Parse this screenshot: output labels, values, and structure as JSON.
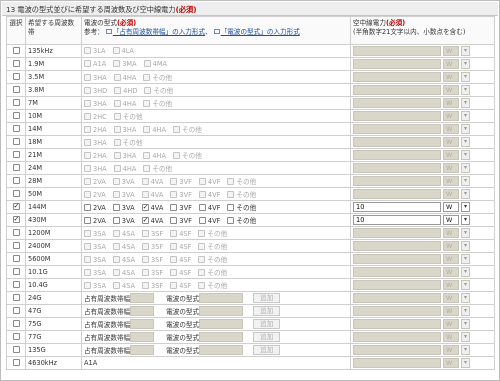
{
  "section": {
    "title_prefix": "13 電波の型式並びに希望する周波数及び空中線電力",
    "title_required": "(必須)"
  },
  "header": {
    "select_label": "選択",
    "band_label": "希望する周波数帯",
    "type_label": "電波の型式",
    "type_required": "(必須)",
    "type_ref_prefix": "参考：",
    "type_link1": "「占有周波数帯幅」の入力形式",
    "type_link_sep": "、",
    "type_link2": "「電波の型式」の入力形式",
    "power_label": "空中線電力",
    "power_required": "(必須)",
    "power_note": "(半角数字21文字以内、小数点を含む)"
  },
  "rows": [
    {
      "band": "135kHz",
      "checked": false,
      "options": [
        {
          "label": "3LA",
          "on": false,
          "dis": true
        },
        {
          "label": "4LA",
          "on": false,
          "dis": true
        }
      ],
      "power": "",
      "unit": "W",
      "enabled": false
    },
    {
      "band": "1.9M",
      "checked": false,
      "options": [
        {
          "label": "A1A",
          "on": false,
          "dis": true
        },
        {
          "label": "3MA",
          "on": false,
          "dis": true
        },
        {
          "label": "4MA",
          "on": false,
          "dis": true
        }
      ],
      "power": "",
      "unit": "W",
      "enabled": false
    },
    {
      "band": "3.5M",
      "checked": false,
      "options": [
        {
          "label": "3HA",
          "on": false,
          "dis": true
        },
        {
          "label": "4HA",
          "on": false,
          "dis": true
        },
        {
          "label": "その他",
          "on": false,
          "dis": true
        }
      ],
      "power": "",
      "unit": "W",
      "enabled": false
    },
    {
      "band": "3.8M",
      "checked": false,
      "options": [
        {
          "label": "3HD",
          "on": false,
          "dis": true
        },
        {
          "label": "4HD",
          "on": false,
          "dis": true
        },
        {
          "label": "その他",
          "on": false,
          "dis": true
        }
      ],
      "power": "",
      "unit": "W",
      "enabled": false
    },
    {
      "band": "7M",
      "checked": false,
      "options": [
        {
          "label": "3HA",
          "on": false,
          "dis": true
        },
        {
          "label": "4HA",
          "on": false,
          "dis": true
        },
        {
          "label": "その他",
          "on": false,
          "dis": true
        }
      ],
      "power": "",
      "unit": "W",
      "enabled": false
    },
    {
      "band": "10M",
      "checked": false,
      "options": [
        {
          "label": "2HC",
          "on": false,
          "dis": true
        },
        {
          "label": "その他",
          "on": false,
          "dis": true
        }
      ],
      "power": "",
      "unit": "W",
      "enabled": false
    },
    {
      "band": "14M",
      "checked": false,
      "options": [
        {
          "label": "2HA",
          "on": false,
          "dis": true
        },
        {
          "label": "3HA",
          "on": false,
          "dis": true
        },
        {
          "label": "4HA",
          "on": false,
          "dis": true
        },
        {
          "label": "その他",
          "on": false,
          "dis": true
        }
      ],
      "power": "",
      "unit": "W",
      "enabled": false
    },
    {
      "band": "18M",
      "checked": false,
      "options": [
        {
          "label": "3HA",
          "on": false,
          "dis": true
        },
        {
          "label": "その他",
          "on": false,
          "dis": true
        }
      ],
      "power": "",
      "unit": "W",
      "enabled": false
    },
    {
      "band": "21M",
      "checked": false,
      "options": [
        {
          "label": "2HA",
          "on": false,
          "dis": true
        },
        {
          "label": "3HA",
          "on": false,
          "dis": true
        },
        {
          "label": "4HA",
          "on": false,
          "dis": true
        },
        {
          "label": "その他",
          "on": false,
          "dis": true
        }
      ],
      "power": "",
      "unit": "W",
      "enabled": false
    },
    {
      "band": "24M",
      "checked": false,
      "options": [
        {
          "label": "3HA",
          "on": false,
          "dis": true
        },
        {
          "label": "4HA",
          "on": false,
          "dis": true
        },
        {
          "label": "その他",
          "on": false,
          "dis": true
        }
      ],
      "power": "",
      "unit": "W",
      "enabled": false
    },
    {
      "band": "28M",
      "checked": false,
      "options": [
        {
          "label": "2VA",
          "on": false,
          "dis": true
        },
        {
          "label": "3VA",
          "on": false,
          "dis": true
        },
        {
          "label": "4VA",
          "on": false,
          "dis": true
        },
        {
          "label": "3VF",
          "on": false,
          "dis": true
        },
        {
          "label": "4VF",
          "on": false,
          "dis": true
        },
        {
          "label": "その他",
          "on": false,
          "dis": true
        }
      ],
      "power": "",
      "unit": "W",
      "enabled": false
    },
    {
      "band": "50M",
      "checked": false,
      "options": [
        {
          "label": "2VA",
          "on": false,
          "dis": true
        },
        {
          "label": "3VA",
          "on": false,
          "dis": true
        },
        {
          "label": "4VA",
          "on": false,
          "dis": true
        },
        {
          "label": "3VF",
          "on": false,
          "dis": true
        },
        {
          "label": "4VF",
          "on": false,
          "dis": true
        },
        {
          "label": "その他",
          "on": false,
          "dis": true
        }
      ],
      "power": "",
      "unit": "W",
      "enabled": false
    },
    {
      "band": "144M",
      "checked": true,
      "options": [
        {
          "label": "2VA",
          "on": false,
          "dis": false
        },
        {
          "label": "3VA",
          "on": false,
          "dis": false
        },
        {
          "label": "4VA",
          "on": true,
          "dis": false
        },
        {
          "label": "3VF",
          "on": false,
          "dis": false
        },
        {
          "label": "4VF",
          "on": false,
          "dis": false
        },
        {
          "label": "その他",
          "on": false,
          "dis": false
        }
      ],
      "power": "10",
      "unit": "W",
      "enabled": true
    },
    {
      "band": "430M",
      "checked": true,
      "options": [
        {
          "label": "2VA",
          "on": false,
          "dis": false
        },
        {
          "label": "3VA",
          "on": false,
          "dis": false
        },
        {
          "label": "4VA",
          "on": true,
          "dis": false
        },
        {
          "label": "3VF",
          "on": false,
          "dis": false
        },
        {
          "label": "4VF",
          "on": false,
          "dis": false
        },
        {
          "label": "その他",
          "on": false,
          "dis": false
        }
      ],
      "power": "10",
      "unit": "W",
      "enabled": true
    },
    {
      "band": "1200M",
      "checked": false,
      "options": [
        {
          "label": "3SA",
          "on": false,
          "dis": true
        },
        {
          "label": "4SA",
          "on": false,
          "dis": true
        },
        {
          "label": "3SF",
          "on": false,
          "dis": true
        },
        {
          "label": "4SF",
          "on": false,
          "dis": true
        },
        {
          "label": "その他",
          "on": false,
          "dis": true
        }
      ],
      "power": "",
      "unit": "W",
      "enabled": false
    },
    {
      "band": "2400M",
      "checked": false,
      "options": [
        {
          "label": "3SA",
          "on": false,
          "dis": true
        },
        {
          "label": "4SA",
          "on": false,
          "dis": true
        },
        {
          "label": "3SF",
          "on": false,
          "dis": true
        },
        {
          "label": "4SF",
          "on": false,
          "dis": true
        },
        {
          "label": "その他",
          "on": false,
          "dis": true
        }
      ],
      "power": "",
      "unit": "W",
      "enabled": false
    },
    {
      "band": "5600M",
      "checked": false,
      "options": [
        {
          "label": "3SA",
          "on": false,
          "dis": true
        },
        {
          "label": "4SA",
          "on": false,
          "dis": true
        },
        {
          "label": "3SF",
          "on": false,
          "dis": true
        },
        {
          "label": "4SF",
          "on": false,
          "dis": true
        },
        {
          "label": "その他",
          "on": false,
          "dis": true
        }
      ],
      "power": "",
      "unit": "W",
      "enabled": false
    },
    {
      "band": "10.1G",
      "checked": false,
      "options": [
        {
          "label": "3SA",
          "on": false,
          "dis": true
        },
        {
          "label": "4SA",
          "on": false,
          "dis": true
        },
        {
          "label": "3SF",
          "on": false,
          "dis": true
        },
        {
          "label": "4SF",
          "on": false,
          "dis": true
        },
        {
          "label": "その他",
          "on": false,
          "dis": true
        }
      ],
      "power": "",
      "unit": "W",
      "enabled": false
    },
    {
      "band": "10.4G",
      "checked": false,
      "options": [
        {
          "label": "3SA",
          "on": false,
          "dis": true
        },
        {
          "label": "4SA",
          "on": false,
          "dis": true
        },
        {
          "label": "3SF",
          "on": false,
          "dis": true
        },
        {
          "label": "4SF",
          "on": false,
          "dis": true
        },
        {
          "label": "その他",
          "on": false,
          "dis": true
        }
      ],
      "power": "",
      "unit": "W",
      "enabled": false
    }
  ],
  "band_rows": [
    {
      "band": "24G",
      "checked": false,
      "power": "",
      "unit": "W",
      "enabled": false
    },
    {
      "band": "47G",
      "checked": false,
      "power": "",
      "unit": "W",
      "enabled": false
    },
    {
      "band": "75G",
      "checked": false,
      "power": "",
      "unit": "W",
      "enabled": false
    },
    {
      "band": "77G",
      "checked": false,
      "power": "",
      "unit": "W",
      "enabled": false
    },
    {
      "band": "135G",
      "checked": false,
      "power": "",
      "unit": "W",
      "enabled": false
    }
  ],
  "band_row_labels": {
    "occupied_bw": "占有周波数帯幅",
    "emission_type": "電波の型式",
    "add": "追加"
  },
  "last_row": {
    "band": "4630kHz",
    "type": "A1A",
    "power": "",
    "unit": "W",
    "enabled": false
  }
}
